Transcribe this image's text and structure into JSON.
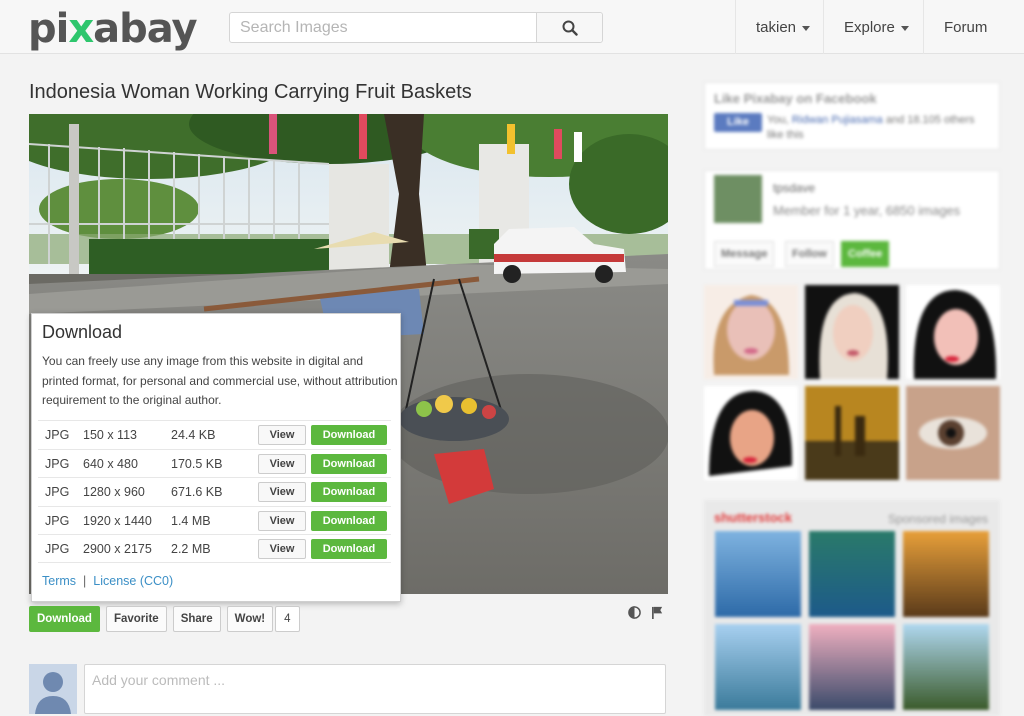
{
  "header": {
    "logo_pre": "pi",
    "logo_x": "x",
    "logo_post": "abay",
    "search_placeholder": "Search Images",
    "nav": [
      "takien",
      "Explore",
      "Forum"
    ]
  },
  "main": {
    "title": "Indonesia Woman Working Carrying Fruit Baskets",
    "download_popup": {
      "title": "Download",
      "text": "You can freely use any image from this website in digital and printed format, for personal and commercial use, without attribution requirement to the original author.",
      "view_label": "View",
      "download_label": "Download",
      "rows": [
        {
          "type": "JPG",
          "dims": "150 x 113",
          "size": "24.4 KB"
        },
        {
          "type": "JPG",
          "dims": "640 x 480",
          "size": "170.5 KB"
        },
        {
          "type": "JPG",
          "dims": "1280 x 960",
          "size": "671.6 KB"
        },
        {
          "type": "JPG",
          "dims": "1920 x 1440",
          "size": "1.4 MB"
        },
        {
          "type": "JPG",
          "dims": "2900 x 2175",
          "size": "2.2 MB"
        }
      ],
      "terms_label": "Terms",
      "separator": "|",
      "license_label": "License (CC0)"
    },
    "actions": {
      "download": "Download",
      "favorite": "Favorite",
      "share": "Share",
      "wow": "Wow!",
      "wow_count": "4"
    },
    "comment_placeholder": "Add your comment ..."
  },
  "sidebar": {
    "facebook": {
      "title": "Like Pixabay on Facebook",
      "like_label": "Like",
      "text_prefix": "You, ",
      "text_name": "Ridwan Pujiasama",
      "text_suffix": " and 18.105 others like this"
    },
    "user": {
      "name": "tpsdave",
      "member": "Member for 1 year, 6850 images",
      "message": "Message",
      "follow": "Follow",
      "coffee": "Coffee"
    },
    "sponsor": {
      "brand": "shutterstock",
      "label": "Sponsored images"
    }
  },
  "colors": {
    "accent_green": "#5cb83e",
    "link_blue": "#3b8fc6"
  }
}
